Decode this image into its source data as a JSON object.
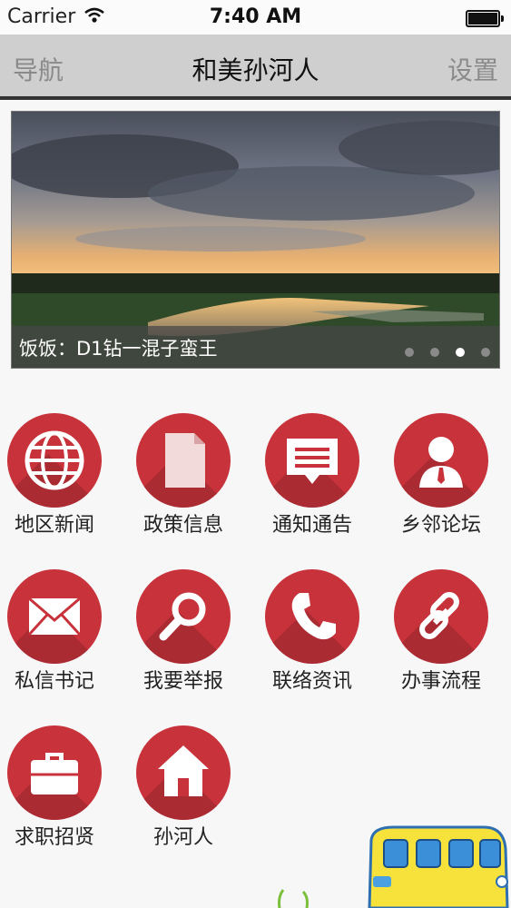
{
  "status_bar": {
    "carrier": "Carrier",
    "time": "7:40 AM"
  },
  "nav": {
    "left": "导航",
    "title": "和美孙河人",
    "right": "设置"
  },
  "banner": {
    "caption": "饭饭：D1钻一混子蛮王",
    "active_dot": 3,
    "dot_count": 4
  },
  "menu": [
    {
      "label": "地区新闻",
      "icon": "globe-icon"
    },
    {
      "label": "政策信息",
      "icon": "document-icon"
    },
    {
      "label": "通知通告",
      "icon": "message-icon"
    },
    {
      "label": "乡邻论坛",
      "icon": "user-icon"
    },
    {
      "label": "私信书记",
      "icon": "mail-icon"
    },
    {
      "label": "我要举报",
      "icon": "search-icon"
    },
    {
      "label": "联络资讯",
      "icon": "phone-icon"
    },
    {
      "label": "办事流程",
      "icon": "link-icon"
    },
    {
      "label": "求职招贤",
      "icon": "briefcase-icon"
    },
    {
      "label": "孙河人",
      "icon": "home-icon"
    }
  ],
  "colors": {
    "icon_bg": "#c8323a",
    "nav_bg": "#cfcfcf"
  }
}
